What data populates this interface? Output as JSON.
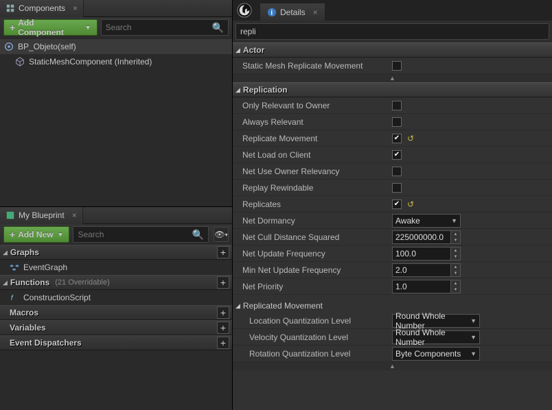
{
  "components": {
    "tab_title": "Components",
    "add_btn": "Add Component",
    "search_placeholder": "Search",
    "root": "BP_Objeto(self)",
    "child": "StaticMeshComponent (Inherited)"
  },
  "myblueprint": {
    "tab_title": "My Blueprint",
    "add_btn": "Add New",
    "search_placeholder": "Search",
    "categories": {
      "graphs": {
        "title": "Graphs",
        "item": "EventGraph"
      },
      "functions": {
        "title": "Functions",
        "hint": "(21 Overridable)",
        "item": "ConstructionScript"
      },
      "macros": {
        "title": "Macros"
      },
      "variables": {
        "title": "Variables"
      },
      "dispatchers": {
        "title": "Event Dispatchers"
      }
    }
  },
  "details": {
    "tab_title": "Details",
    "filter_value": "repli",
    "sections": {
      "actor": {
        "title": "Actor",
        "static_mesh_rep": "Static Mesh Replicate Movement"
      },
      "replication": {
        "title": "Replication",
        "props": {
          "only_relevant": "Only Relevant to Owner",
          "always_relevant": "Always Relevant",
          "replicate_movement": "Replicate Movement",
          "net_load": "Net Load on Client",
          "net_use_owner": "Net Use Owner Relevancy",
          "replay_rewind": "Replay Rewindable",
          "replicates": "Replicates",
          "net_dormancy": {
            "label": "Net Dormancy",
            "value": "Awake"
          },
          "net_cull": {
            "label": "Net Cull Distance Squared",
            "value": "225000000.0"
          },
          "net_update_freq": {
            "label": "Net Update Frequency",
            "value": "100.0"
          },
          "min_net_update": {
            "label": "Min Net Update Frequency",
            "value": "2.0"
          },
          "net_priority": {
            "label": "Net Priority",
            "value": "1.0"
          }
        },
        "repmove": {
          "title": "Replicated Movement",
          "loc_quant": {
            "label": "Location Quantization Level",
            "value": "Round Whole Number"
          },
          "vel_quant": {
            "label": "Velocity Quantization Level",
            "value": "Round Whole Number"
          },
          "rot_quant": {
            "label": "Rotation Quantization Level",
            "value": "Byte Components"
          }
        }
      }
    }
  }
}
